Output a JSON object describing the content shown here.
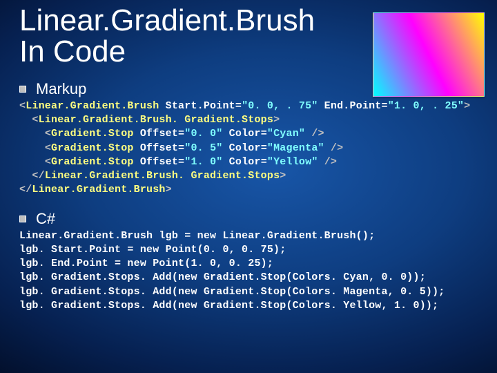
{
  "title_line1": "Linear.Gradient.Brush",
  "title_line2": "In Code",
  "swatch": {
    "start": "0,0.75",
    "end": "1,0.25",
    "stops": [
      {
        "offset": 0.0,
        "color": "cyan"
      },
      {
        "offset": 0.5,
        "color": "magenta"
      },
      {
        "offset": 1.0,
        "color": "yellow"
      }
    ]
  },
  "sections": {
    "markup": {
      "label": "Markup",
      "code": [
        [
          {
            "c": "lt",
            "t": "<"
          },
          {
            "c": "tag",
            "t": "Linear.Gradient.Brush"
          },
          {
            "c": "att",
            "t": " Start.Point="
          },
          {
            "c": "str",
            "t": "\"0. 0, . 75\""
          },
          {
            "c": "att",
            "t": " End.Point="
          },
          {
            "c": "str",
            "t": "\"1. 0, . 25\""
          },
          {
            "c": "lt",
            "t": ">"
          }
        ],
        [
          {
            "c": "att",
            "t": "  "
          },
          {
            "c": "lt",
            "t": "<"
          },
          {
            "c": "tag",
            "t": "Linear.Gradient.Brush. Gradient.Stops"
          },
          {
            "c": "lt",
            "t": ">"
          }
        ],
        [
          {
            "c": "att",
            "t": "    "
          },
          {
            "c": "lt",
            "t": "<"
          },
          {
            "c": "tag",
            "t": "Gradient.Stop"
          },
          {
            "c": "att",
            "t": " Offset="
          },
          {
            "c": "str",
            "t": "\"0. 0\""
          },
          {
            "c": "att",
            "t": " Color="
          },
          {
            "c": "str",
            "t": "\"Cyan\""
          },
          {
            "c": "att",
            "t": " "
          },
          {
            "c": "lt",
            "t": "/>"
          }
        ],
        [
          {
            "c": "att",
            "t": "    "
          },
          {
            "c": "lt",
            "t": "<"
          },
          {
            "c": "tag",
            "t": "Gradient.Stop"
          },
          {
            "c": "att",
            "t": " Offset="
          },
          {
            "c": "str",
            "t": "\"0. 5\""
          },
          {
            "c": "att",
            "t": " Color="
          },
          {
            "c": "str",
            "t": "\"Magenta\""
          },
          {
            "c": "att",
            "t": " "
          },
          {
            "c": "lt",
            "t": "/>"
          }
        ],
        [
          {
            "c": "att",
            "t": "    "
          },
          {
            "c": "lt",
            "t": "<"
          },
          {
            "c": "tag",
            "t": "Gradient.Stop"
          },
          {
            "c": "att",
            "t": " Offset="
          },
          {
            "c": "str",
            "t": "\"1. 0\""
          },
          {
            "c": "att",
            "t": " Color="
          },
          {
            "c": "str",
            "t": "\"Yellow\""
          },
          {
            "c": "att",
            "t": " "
          },
          {
            "c": "lt",
            "t": "/>"
          }
        ],
        [
          {
            "c": "att",
            "t": "  "
          },
          {
            "c": "lt",
            "t": "</"
          },
          {
            "c": "tag",
            "t": "Linear.Gradient.Brush. Gradient.Stops"
          },
          {
            "c": "lt",
            "t": ">"
          }
        ],
        [
          {
            "c": "lt",
            "t": "</"
          },
          {
            "c": "tag",
            "t": "Linear.Gradient.Brush"
          },
          {
            "c": "lt",
            "t": ">"
          }
        ]
      ]
    },
    "csharp": {
      "label": "C#",
      "code": [
        [
          {
            "c": "att",
            "t": "Linear.Gradient.Brush lgb = new Linear.Gradient.Brush();"
          }
        ],
        [
          {
            "c": "att",
            "t": "lgb. Start.Point = new Point(0. 0, 0. 75);"
          }
        ],
        [
          {
            "c": "att",
            "t": "lgb. End.Point = new Point(1. 0, 0. 25);"
          }
        ],
        [
          {
            "c": "att",
            "t": "lgb. Gradient.Stops. Add(new Gradient.Stop(Colors. Cyan, 0. 0));"
          }
        ],
        [
          {
            "c": "att",
            "t": "lgb. Gradient.Stops. Add(new Gradient.Stop(Colors. Magenta, 0. 5));"
          }
        ],
        [
          {
            "c": "att",
            "t": "lgb. Gradient.Stops. Add(new Gradient.Stop(Colors. Yellow, 1. 0));"
          }
        ]
      ]
    }
  }
}
